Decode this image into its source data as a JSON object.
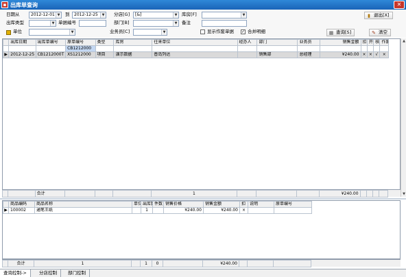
{
  "window": {
    "title": "出库单查询",
    "close_glyph": "✕"
  },
  "filters": {
    "date_from_label": "日期从",
    "date_from": "2012-12-01",
    "date_to_label": "到",
    "date_to": "2012-12-25",
    "branch_label": "分店[G]",
    "branch_value": "[&]",
    "warehouse_label": "库房[F]",
    "warehouse_value": "",
    "out_type_label": "出库类型",
    "out_type_value": "",
    "doc_no_label": "单据编号",
    "doc_no_value": "",
    "dept_label": "部门[B]",
    "dept_value": "",
    "remark_label": "备注",
    "remark_value": "",
    "unit_label": "单位",
    "unit_value": "",
    "salesman_label": "业务员[C]",
    "salesman_value": "",
    "show_voided_label": "显示作废单据",
    "show_voided_checked": false,
    "merge_label": "合并明细",
    "merge_checked": true
  },
  "toolbar": {
    "exit_label": "退出[X]",
    "query_label": "查询[S]",
    "clear_label": "清空"
  },
  "main_grid": {
    "columns": [
      "出库日期",
      "出库单编号",
      "原单编号",
      "类型",
      "库房",
      "往来单位",
      "经办人",
      "部门",
      "业务员",
      "销售金额",
      "扣",
      "开",
      "核",
      "作废"
    ],
    "filter_row": [
      "",
      "",
      "CB1212000",
      "",
      "",
      "",
      "",
      "",
      "",
      "",
      "",
      "",
      "",
      ""
    ],
    "rows": [
      [
        "2012-12-25",
        "CB1212000T",
        "XS1212000",
        "项目",
        "演示数据",
        "普岛列达",
        "",
        "销售部",
        "总经理",
        "¥240.00",
        "×",
        "×",
        "√",
        "×"
      ]
    ],
    "totals": {
      "label": "合计",
      "count": "1",
      "amount": "¥240.00"
    }
  },
  "detail_grid": {
    "columns": [
      "商品编码",
      "商品名称",
      "单位",
      "出库数",
      "件数",
      "销售价格",
      "销售金额",
      "扣",
      "说明",
      "原单编号"
    ],
    "rows": [
      [
        "100002",
        "通笔王纸",
        "",
        "1",
        "",
        "¥240.00",
        "¥240.00",
        "×",
        "",
        ""
      ]
    ],
    "totals": {
      "label": "合计",
      "count": "1",
      "qty": "1",
      "pieces": "0",
      "amount": "¥240.00"
    }
  },
  "tabs": [
    "查询控制->",
    "分店控制",
    "部门控制"
  ]
}
